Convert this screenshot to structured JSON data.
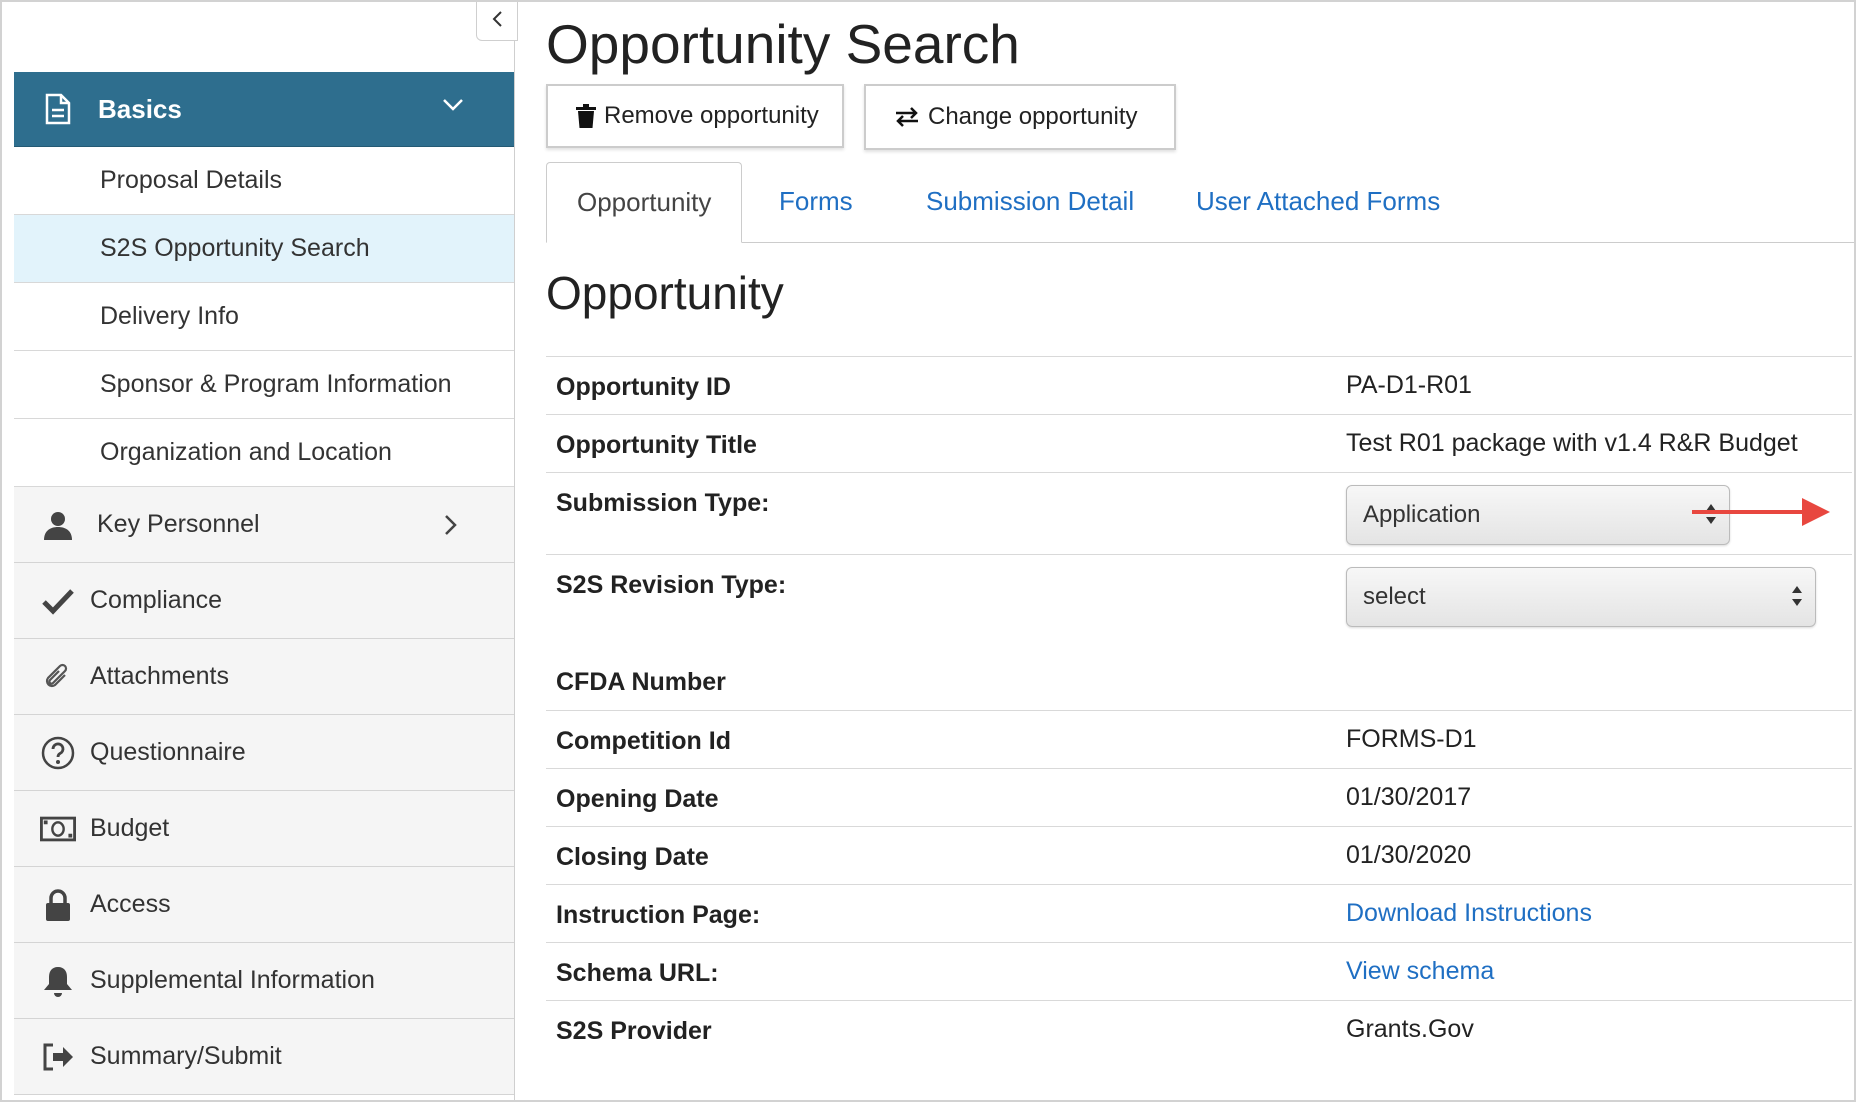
{
  "sidebar": {
    "section": {
      "label": "Basics",
      "icon": "document-icon"
    },
    "sub_items": [
      {
        "label": "Proposal Details"
      },
      {
        "label": "S2S Opportunity Search",
        "active": true
      },
      {
        "label": "Delivery Info"
      },
      {
        "label": "Sponsor & Program Information"
      },
      {
        "label": "Organization and Location"
      }
    ],
    "nav_items": [
      {
        "label": "Key Personnel",
        "icon": "person-icon"
      },
      {
        "label": "Compliance",
        "icon": "checkmark-icon"
      },
      {
        "label": "Attachments",
        "icon": "paperclip-icon"
      },
      {
        "label": "Questionnaire",
        "icon": "question-circle-icon"
      },
      {
        "label": "Budget",
        "icon": "money-icon"
      },
      {
        "label": "Access",
        "icon": "lock-icon"
      },
      {
        "label": "Supplemental Information",
        "icon": "bell-icon"
      },
      {
        "label": "Summary/Submit",
        "icon": "sign-out-icon"
      }
    ]
  },
  "main": {
    "title": "Opportunity Search",
    "buttons": {
      "remove": "Remove opportunity",
      "change": "Change opportunity"
    },
    "tabs": [
      {
        "label": "Opportunity",
        "active": true
      },
      {
        "label": "Forms"
      },
      {
        "label": "Submission Detail"
      },
      {
        "label": "User Attached Forms"
      }
    ],
    "section_title": "Opportunity",
    "fields": {
      "opportunity_id": {
        "label": "Opportunity ID",
        "value": "PA-D1-R01"
      },
      "opportunity_title": {
        "label": "Opportunity Title",
        "value": "Test R01 package with v1.4 R&R Budget"
      },
      "submission_type": {
        "label": "Submission Type:",
        "value": "Application"
      },
      "revision_type": {
        "label": "S2S Revision Type:",
        "value": "select"
      },
      "cfda_number": {
        "label": "CFDA Number",
        "value": ""
      },
      "competition_id": {
        "label": "Competition Id",
        "value": "FORMS-D1"
      },
      "opening_date": {
        "label": "Opening Date",
        "value": "01/30/2017"
      },
      "closing_date": {
        "label": "Closing Date",
        "value": "01/30/2020"
      },
      "instruction_page": {
        "label": "Instruction Page:",
        "value": "Download Instructions"
      },
      "schema_url": {
        "label": "Schema URL:",
        "value": "View schema"
      },
      "s2s_provider": {
        "label": "S2S Provider",
        "value": "Grants.Gov"
      }
    }
  },
  "colors": {
    "sidebar_header": "#2e6e8e",
    "active_item": "#e2f3fb",
    "link": "#1f6fc3",
    "annotation_arrow": "#e8473f"
  }
}
